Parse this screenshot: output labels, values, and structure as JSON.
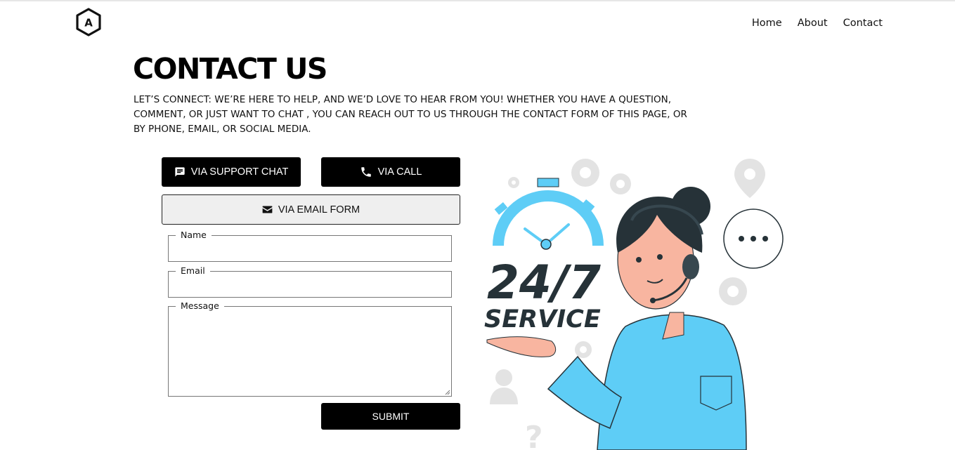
{
  "nav": {
    "logo_letter": "A",
    "links": [
      "Home",
      "About",
      "Contact"
    ]
  },
  "header": {
    "title": "CONTACT US",
    "intro": "LET’S CONNECT: WE’RE HERE TO HELP, AND WE’D LOVE TO HEAR FROM YOU! WHETHER YOU HAVE A QUESTION, COMMENT, OR JUST WANT TO CHAT , YOU CAN REACH OUT TO US THROUGH THE CONTACT FORM OF THIS PAGE, OR BY PHONE, EMAIL, OR SOCIAL MEDIA."
  },
  "contact_options": {
    "chat_label": "VIA SUPPORT CHAT",
    "call_label": "VIA CALL",
    "email_label": "VIA EMAIL FORM"
  },
  "form": {
    "name_label": "Name",
    "name_value": "",
    "email_label": "Email",
    "email_value": "",
    "message_label": "Message",
    "message_value": "",
    "submit_label": "SUBMIT"
  },
  "illustration": {
    "big_text": "24/7",
    "sub_text": "SERVICE",
    "accent": "#5ecdf6",
    "dark": "#263238"
  },
  "colors": {
    "primary_button": "#000000",
    "secondary_button": "#efefef"
  }
}
